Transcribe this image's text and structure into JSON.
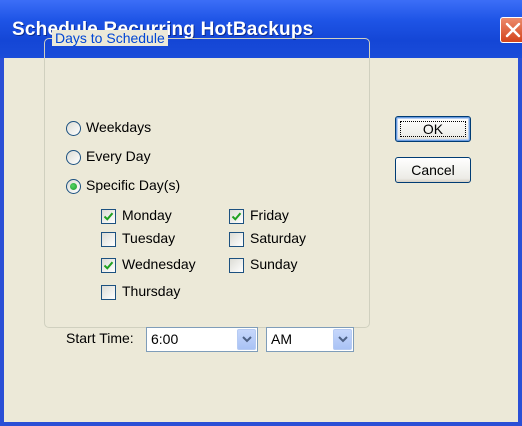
{
  "window": {
    "title": "Schedule Recurring HotBackups",
    "close_icon": "close-icon"
  },
  "days_group": {
    "label": "Days to Schedule",
    "options": [
      {
        "label": "Weekdays",
        "selected": false
      },
      {
        "label": "Every Day",
        "selected": false
      },
      {
        "label": "Specific Day(s)",
        "selected": true
      }
    ],
    "days": [
      {
        "label": "Monday",
        "checked": true
      },
      {
        "label": "Tuesday",
        "checked": false
      },
      {
        "label": "Wednesday",
        "checked": true
      },
      {
        "label": "Thursday",
        "checked": false
      },
      {
        "label": "Friday",
        "checked": true
      },
      {
        "label": "Saturday",
        "checked": false
      },
      {
        "label": "Sunday",
        "checked": false
      }
    ]
  },
  "start_time": {
    "label": "Start Time:",
    "time_value": "6:00",
    "ampm_value": "AM"
  },
  "buttons": {
    "ok": "OK",
    "cancel": "Cancel"
  },
  "colors": {
    "title_bar": "#1e54e6",
    "dialog_face": "#ece9d8",
    "group_label": "#0046d5",
    "close_button": "#d4441c"
  }
}
